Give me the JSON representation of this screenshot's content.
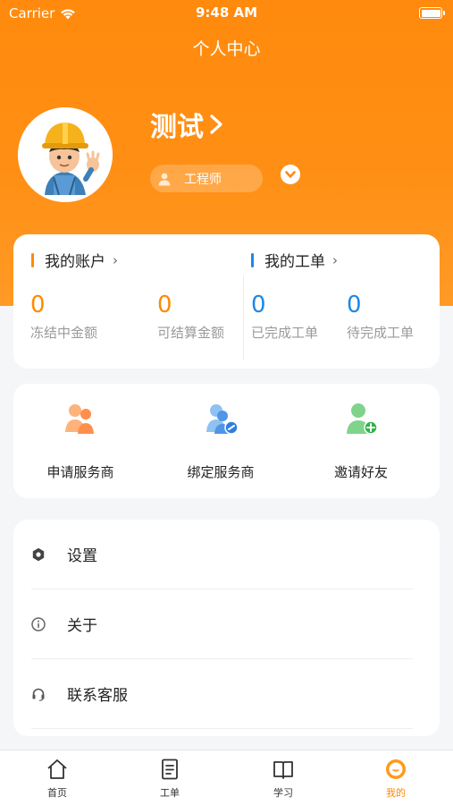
{
  "status_bar": {
    "carrier": "Carrier",
    "time": "9:48 AM"
  },
  "nav": {
    "title": "个人中心"
  },
  "profile": {
    "name": "测试",
    "role": "工程师"
  },
  "account": {
    "title": "我的账户",
    "accent": "#ff8a00",
    "stats": [
      {
        "value": "0",
        "label": "冻结中金额"
      },
      {
        "value": "0",
        "label": "可结算金额"
      }
    ]
  },
  "workorder": {
    "title": "我的工单",
    "accent": "#1e88e5",
    "stats": [
      {
        "value": "0",
        "label": "已完成工单"
      },
      {
        "value": "0",
        "label": "待完成工单"
      }
    ]
  },
  "shortcuts": [
    {
      "label": "申请服务商",
      "icon": "apply-provider-icon"
    },
    {
      "label": "绑定服务商",
      "icon": "bind-provider-icon"
    },
    {
      "label": "邀请好友",
      "icon": "invite-friend-icon"
    }
  ],
  "menu": [
    {
      "label": "设置",
      "icon": "settings-icon"
    },
    {
      "label": "关于",
      "icon": "info-icon"
    },
    {
      "label": "联系客服",
      "icon": "headset-icon"
    }
  ],
  "tabs": [
    {
      "label": "首页",
      "icon": "home-icon",
      "active": false
    },
    {
      "label": "工单",
      "icon": "document-icon",
      "active": false
    },
    {
      "label": "学习",
      "icon": "book-icon",
      "active": false
    },
    {
      "label": "我的",
      "icon": "smile-icon",
      "active": true
    }
  ],
  "colors": {
    "brand": "#ff8a0d",
    "active_tab": "#ff8a00",
    "workorder_blue": "#1e88e5"
  }
}
